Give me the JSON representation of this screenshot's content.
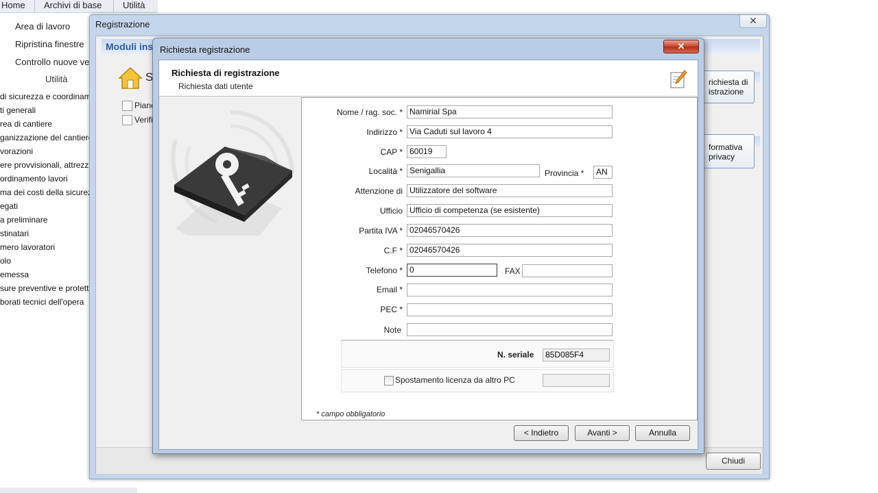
{
  "app": {
    "menu": [
      "Home",
      "Archivi di base",
      "Utilità"
    ],
    "ribbon": {
      "items": [
        "Area di lavoro",
        "Ripristina finestre",
        "Controllo nuove ve"
      ],
      "group_label": "Utilità"
    },
    "tree_items": [
      "di sicurezza e coordiname",
      "ti generali",
      "rea di cantiere",
      "ganizzazione del cantiere",
      "vorazioni",
      "ere provvisionali, attrezz",
      "ordinamento lavori",
      "ma dei costi della sicurez",
      "egati",
      "a preliminare",
      "stinatari",
      "mero lavoratori",
      "olo",
      "emessa",
      "sure preventive e protett",
      "borati tecnici dell'opera"
    ]
  },
  "registrazione_window": {
    "title": "Registrazione",
    "close_glyph": "✕",
    "moduli_label": "Moduli ins",
    "section_label": "Sic",
    "checkbox_labels": [
      "Piano",
      "Verifi"
    ],
    "side_buttons": [
      "richiesta di\nistrazione",
      "formativa\nprivacy"
    ],
    "close_button": "Chiudi"
  },
  "dialog": {
    "title": "Richiesta registrazione",
    "close_glyph": "✕",
    "header_title": "Richiesta di registrazione",
    "header_subtitle": "Richiesta dati utente",
    "fields": {
      "nome_label": "Nome / rag. soc. *",
      "nome_value": "Namirial Spa",
      "indirizzo_label": "Indirizzo *",
      "indirizzo_value": "Via Caduti sul lavoro 4",
      "cap_label": "CAP *",
      "cap_value": "60019",
      "localita_label": "Località *",
      "localita_value": "Senigallia",
      "provincia_label": "Provincia *",
      "provincia_value": "AN",
      "attenzione_label": "Attenzione di",
      "attenzione_value": "Utilizzatore del software",
      "ufficio_label": "Ufficio",
      "ufficio_value": "Ufficio di competenza (se esistente)",
      "piva_label": "Partita IVA *",
      "piva_value": "02046570426",
      "cf_label": "C.F *",
      "cf_value": "02046570426",
      "telefono_label": "Telefono *",
      "telefono_value": "0",
      "fax_label": "FAX",
      "fax_value": "",
      "email_label": "Email *",
      "email_value": "",
      "pec_label": "PEC *",
      "pec_value": "",
      "note_label": "Note",
      "note_value": ""
    },
    "seriale_label": "N. seriale",
    "seriale_value": "85D085F4",
    "spostamento_label": "Spostamento licenza da altro PC",
    "spostamento_checked": false,
    "footnote": "* campo obbligatorio",
    "buttons": {
      "back": "< Indietro",
      "next": "Avanti >",
      "cancel": "Annulla"
    }
  },
  "colors": {
    "dialog_frame": "#b9cde6",
    "close_red": "#c8422b",
    "accent_blue": "#2b5aa0"
  },
  "icons": [
    "home-icon",
    "key-folder-icon",
    "edit-document-icon",
    "close-icon"
  ]
}
